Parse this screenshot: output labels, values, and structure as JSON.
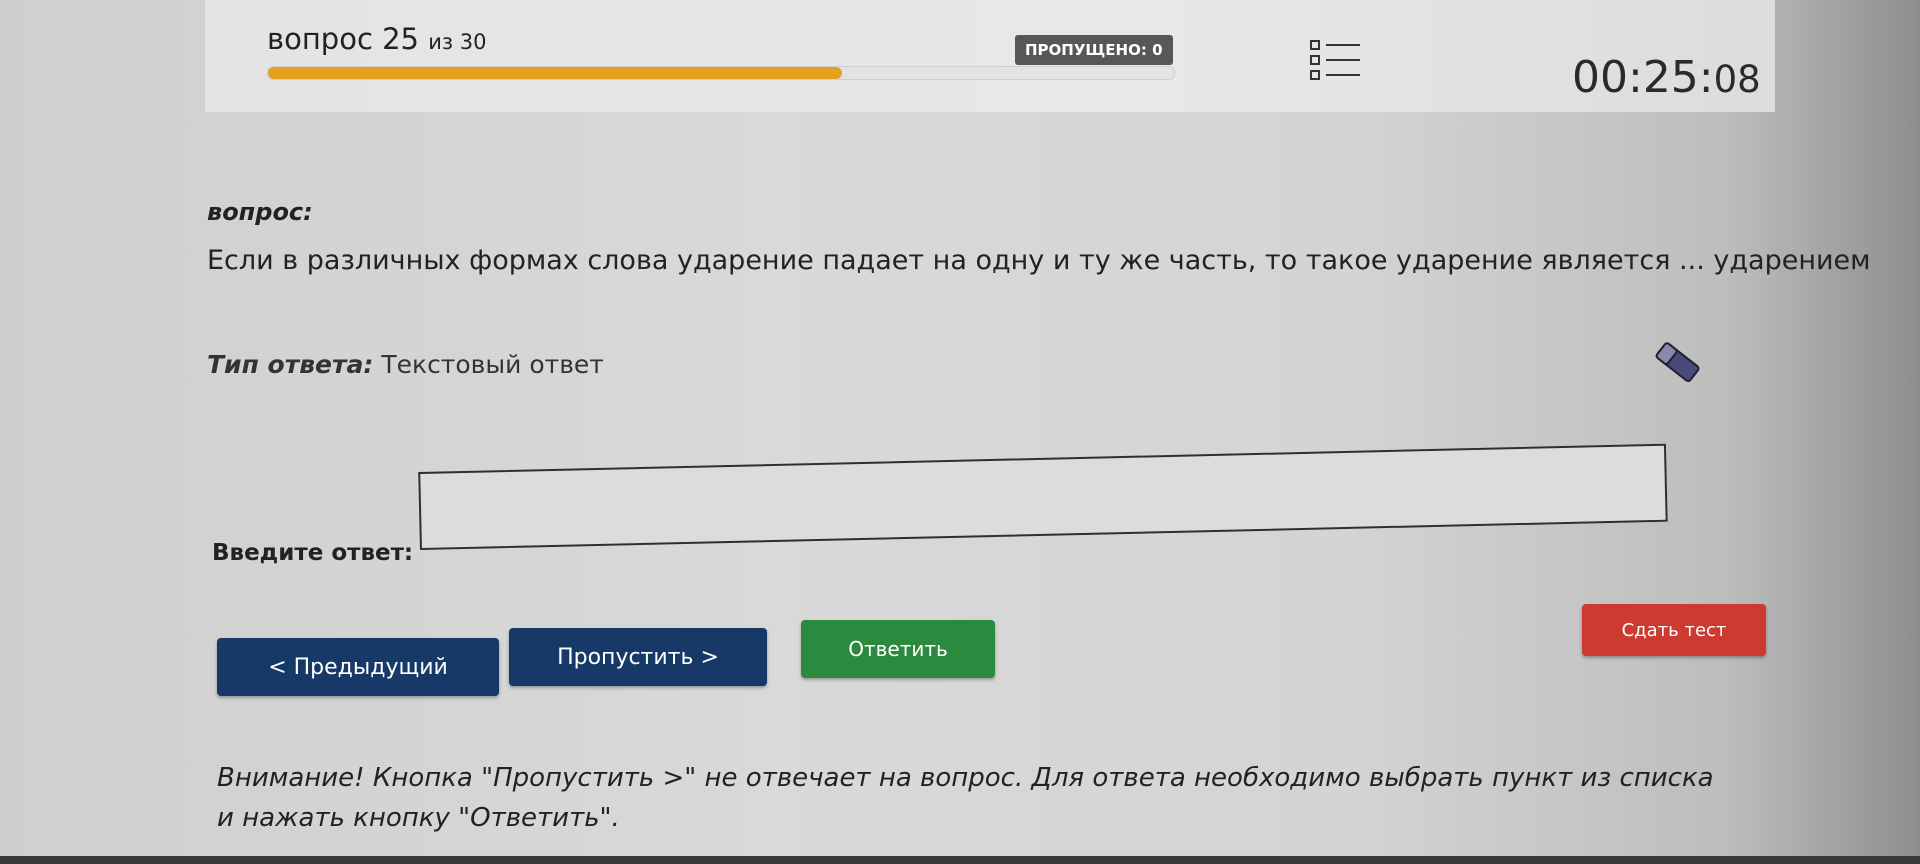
{
  "header": {
    "question_label": "вопрос",
    "question_number": "25",
    "question_of": "из 30",
    "progress_fraction": 0.634,
    "skipped_label": "ПРОПУЩЕНО: 0",
    "list_icon": "question-list-icon",
    "timer_main": "00:25:",
    "timer_seconds": "08"
  },
  "question": {
    "label": "вопрос:",
    "text": "Если в различных формах слова ударение падает на одну и ту же часть, то такое ударение является ... ударением"
  },
  "answer_type": {
    "label": "Тип ответа:",
    "value": "Текстовый ответ",
    "clear_icon": "eraser-icon"
  },
  "answer": {
    "label": "Введите ответ:",
    "value": ""
  },
  "buttons": {
    "previous": "< Предыдущий",
    "skip": "Пропустить >",
    "answer": "Ответить",
    "submit_test": "Сдать тест"
  },
  "warning": {
    "text": "Внимание! Кнопка \"Пропустить >\" не отвечает на вопрос. Для ответа необходимо выбрать пункт из списка и нажать кнопку \"Ответить\"."
  },
  "colors": {
    "progress": "#e4a01e",
    "nav_button": "#163968",
    "answer_button": "#2b8a3e",
    "submit_button": "#cc3a30",
    "badge": "#575757"
  }
}
